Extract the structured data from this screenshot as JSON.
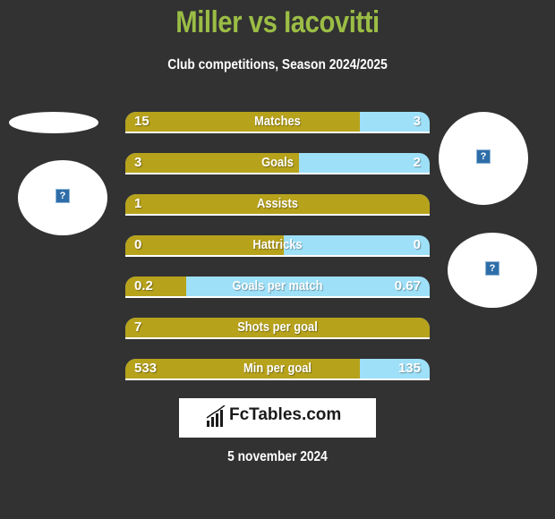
{
  "header": {
    "title": "Miller vs Iacovitti",
    "subtitle": "Club competitions, Season 2024/2025"
  },
  "colors": {
    "title": "#9bbd45",
    "left_player": "#b7a21b",
    "right_player": "#9ee0f8",
    "background": "#323232"
  },
  "stats": [
    {
      "label": "Matches",
      "left": "15",
      "right": "3",
      "left_share": 0.77
    },
    {
      "label": "Goals",
      "left": "3",
      "right": "2",
      "left_share": 0.57
    },
    {
      "label": "Assists",
      "left": "1",
      "right": "",
      "left_share": 1.0
    },
    {
      "label": "Hattricks",
      "left": "0",
      "right": "0",
      "left_share": 0.52
    },
    {
      "label": "Goals per match",
      "left": "0.2",
      "right": "0.67",
      "left_share": 0.2
    },
    {
      "label": "Shots per goal",
      "left": "7",
      "right": "",
      "left_share": 1.0
    },
    {
      "label": "Min per goal",
      "left": "533",
      "right": "135",
      "left_share": 0.77
    }
  ],
  "images": {
    "placeholder_icon": "?"
  },
  "footer": {
    "logo_text": "FcTables.com",
    "date": "5 november 2024"
  }
}
